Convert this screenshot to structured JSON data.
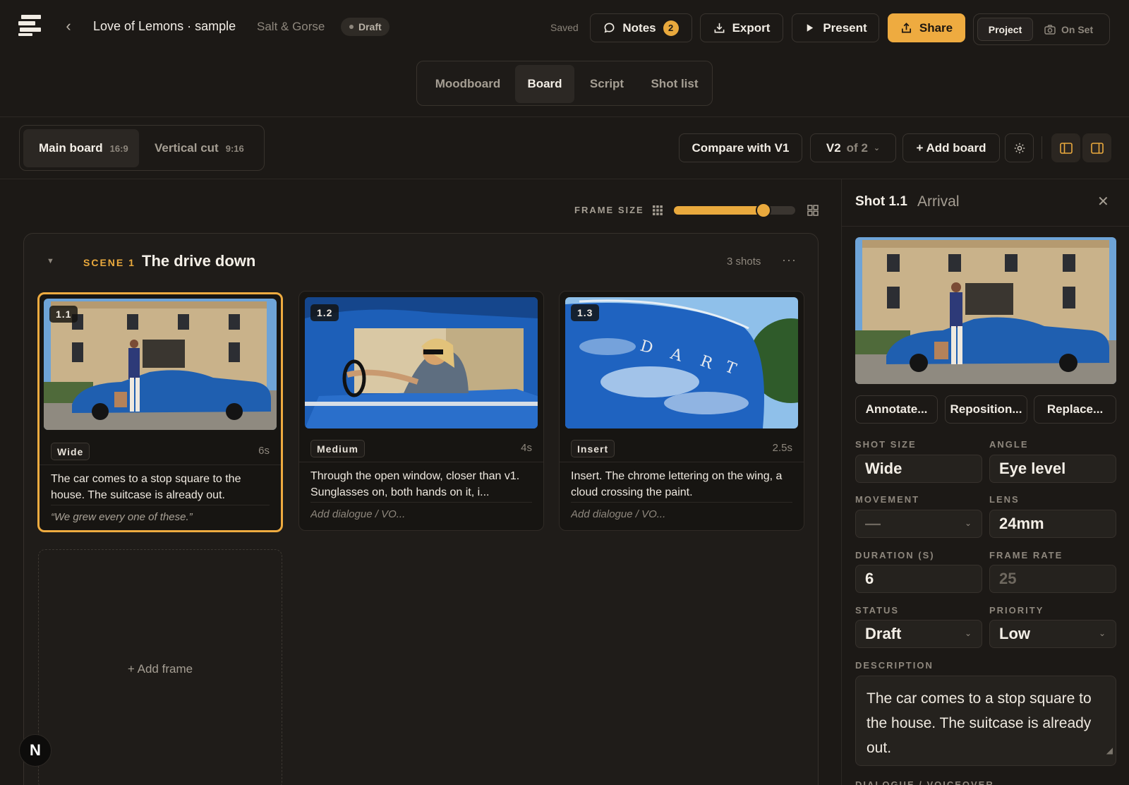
{
  "header": {
    "project_title": "Love of Lemons · sample",
    "client": "Salt & Gorse",
    "status": "Draft",
    "saved_label": "Saved",
    "notes_label": "Notes",
    "notes_count": "2",
    "export_label": "Export",
    "present_label": "Present",
    "share_label": "Share",
    "mode_project": "Project",
    "mode_onset": "On Set"
  },
  "tabs": [
    "Moodboard",
    "Board",
    "Script",
    "Shot list"
  ],
  "active_tab": "Board",
  "boards": [
    {
      "name": "Main board",
      "ratio": "16:9"
    },
    {
      "name": "Vertical cut",
      "ratio": "9:16"
    }
  ],
  "board_actions": {
    "compare_label": "Compare with V1",
    "version_label": "V2",
    "version_of": "of 2",
    "add_board_label": "+ Add board"
  },
  "frame_size": {
    "label": "FRAME SIZE",
    "value_fraction": 0.74
  },
  "scene": {
    "label": "SCENE 1",
    "title": "The drive down",
    "count": "3 shots"
  },
  "shots": [
    {
      "number": "1.1",
      "size": "Wide",
      "duration": "6s",
      "description": "The car comes to a stop square to the house. The suitcase is already out.",
      "dialogue": "“We grew every one of these.”"
    },
    {
      "number": "1.2",
      "size": "Medium",
      "duration": "4s",
      "description": "Through the open window, closer than v1. Sunglasses on, both hands on it, i...",
      "dialogue": "Add dialogue / VO..."
    },
    {
      "number": "1.3",
      "size": "Insert",
      "duration": "2.5s",
      "description": "Insert. The chrome lettering on the wing, a cloud crossing the paint.",
      "dialogue": "Add dialogue / VO..."
    }
  ],
  "add_frame_label": "+ Add frame",
  "badge_letter": "N",
  "panel": {
    "shot": "Shot 1.1",
    "shot_name": "Arrival",
    "annotate_label": "Annotate...",
    "reposition_label": "Reposition...",
    "replace_label": "Replace...",
    "shot_size_label": "SHOT SIZE",
    "shot_size": "Wide",
    "angle_label": "ANGLE",
    "angle": "Eye level",
    "movement_label": "MOVEMENT",
    "movement": "—",
    "lens_label": "LENS",
    "lens": "24mm",
    "duration_label": "DURATION (S)",
    "duration": "6",
    "frame_rate_label": "FRAME RATE",
    "frame_rate": "25",
    "status_label": "STATUS",
    "status": "Draft",
    "priority_label": "PRIORITY",
    "priority": "Low",
    "description_label": "DESCRIPTION",
    "description": "The car comes to a stop square to the house. The suitcase is already out.",
    "next_section_label": "DIALOGUE / VOICEOVER"
  },
  "colors": {
    "accent": "#eeab40",
    "background": "#1c1916",
    "surface": "#25221e",
    "car_blue": "#1f5fb0"
  }
}
